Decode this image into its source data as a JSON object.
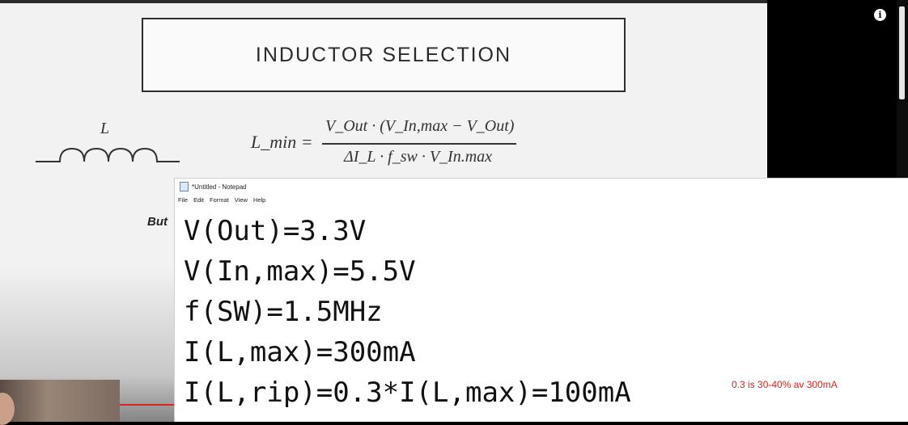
{
  "slide": {
    "title": "INDUCTOR SELECTION",
    "inductor_label": "L",
    "formula": {
      "lhs": "L_min =",
      "numerator": "V_Out · (V_In,max − V_Out)",
      "denominator": "ΔI_L · f_sw · V_In.max"
    },
    "partial_text": "But"
  },
  "notepad": {
    "window_title": "*Untitled - Notepad",
    "menu": [
      "File",
      "Edit",
      "Format",
      "View",
      "Help"
    ],
    "lines": [
      "V(Out)=3.3V",
      "V(In,max)=5.5V",
      "f(SW)=1.5MHz",
      "I(L,max)=300mA",
      "I(L,rip)=0.3*I(L,max)=100mA"
    ],
    "annotation": "0.3 is 30-40% av 300mA",
    "annotation_color": "#e0201a"
  },
  "overlay": {
    "info_icon": "info-icon"
  }
}
